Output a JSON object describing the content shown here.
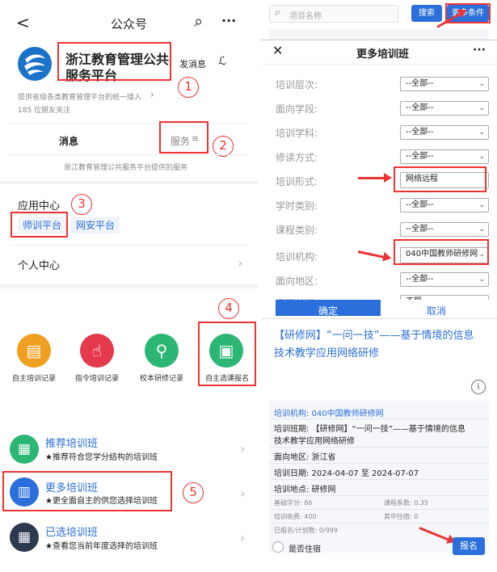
{
  "left": {
    "header": {
      "back": "<",
      "title": "公众号",
      "search": "⌕",
      "more": "···"
    },
    "account": {
      "name_line1": "浙江教育管理公共",
      "name_line2": "服务平台",
      "send_btn": "发消息",
      "follow_icon": "ℒ",
      "desc": "提供省级各类教育管理平台的统一接入",
      "desc_arrow": "›",
      "followers": "185 位朋友关注"
    },
    "tabs": {
      "messages": "消息",
      "service": "服务",
      "service_icon": "≡",
      "service_desc": "浙江教育管理公共服务平台提供的服务"
    },
    "app_center": {
      "title": "应用中心",
      "tag1": "师训平台",
      "tag2": "网安平台"
    },
    "personal": {
      "title": "个人中心"
    },
    "icons": [
      {
        "label": "自主培训记录",
        "glyph": "▤",
        "color": "#f0a020"
      },
      {
        "label": "指令培训记录",
        "glyph": "☝",
        "color": "#e53a4b"
      },
      {
        "label": "校本研修记录",
        "glyph": "⚲",
        "color": "#2bb673"
      },
      {
        "label": "自主选课报名",
        "glyph": "▣",
        "color": "#2bb673"
      }
    ],
    "list": [
      {
        "title": "推荐培训班",
        "desc": "★推荐符合您学分结构的培训班",
        "glyph": "▦",
        "color": "#2bb673"
      },
      {
        "title": "更多培训班",
        "desc": "★更全面自主的供您选择培训班",
        "glyph": "▥",
        "color": "#2a6fdb"
      },
      {
        "title": "已选培训班",
        "desc": "★查看您当前年度选择的培训班",
        "glyph": "▦",
        "color": "#2c3a4f"
      }
    ],
    "markers": [
      "1",
      "2",
      "3",
      "4",
      "5"
    ]
  },
  "right": {
    "search": {
      "placeholder": "项目名称",
      "search_btn": "搜索",
      "more_btn": "更多条件"
    },
    "modal": {
      "close": "✕",
      "title": "更多培训班",
      "more": "···"
    },
    "form": [
      {
        "label": "培训层次:",
        "value": "--全部--"
      },
      {
        "label": "面向学段:",
        "value": "--全部--"
      },
      {
        "label": "培训学科:",
        "value": "--全部--"
      },
      {
        "label": "修读方式:",
        "value": "--全部--"
      },
      {
        "label": "培训形式:",
        "value": "网络远程"
      },
      {
        "label": "学时类别:",
        "value": "--全部--"
      },
      {
        "label": "课程类别:",
        "value": "--全部--"
      },
      {
        "label": "培训机构:",
        "value": "040中国教师研修网"
      },
      {
        "label": "面向地区:",
        "value": "--全部--"
      },
      {
        "label": "是否长期:",
        "value": "不限"
      }
    ],
    "confirm": "确定",
    "cancel": "取消",
    "card": {
      "title_line1": "【研修网】“一问一技”——基于情境的信息",
      "title_line2": "技术教学应用网络研修",
      "info_icon": "i",
      "org": "培训机构: 040中国教师研修网",
      "class_line1": "培训班期: 【研修网】“一问一技”——基于情境的信息",
      "class_line2": "技术教学应用网络研修",
      "region": "面向地区: 浙江省",
      "date": "培训日期: 2024-04-07 至 2024-07-07",
      "place": "培训地点: 研修网",
      "credit": "基础学分: 86",
      "coef": "课程系数: 0.35",
      "fee": "培训收费: 400",
      "board": "其中住宿: 0",
      "enrolled": "已报名/计划数: 0/999",
      "stay": "是否住宿",
      "signup": "报名"
    }
  }
}
